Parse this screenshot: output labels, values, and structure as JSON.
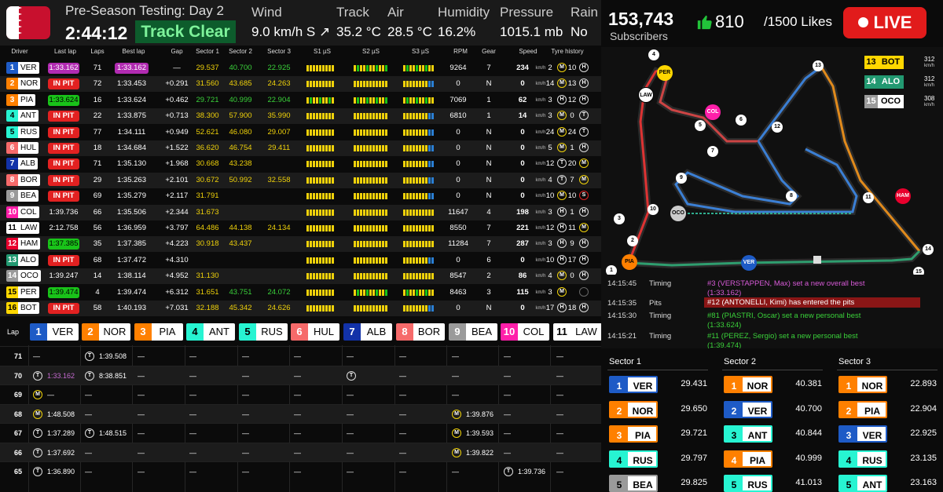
{
  "header": {
    "session": "Pre-Season Testing: Day 2",
    "clock": "2:44:12",
    "track_status": "Track Clear",
    "weather": [
      {
        "label": "Wind",
        "value": "9.0 km/h S ↗"
      },
      {
        "label": "Track",
        "value": "35.2 °C"
      },
      {
        "label": "Air",
        "value": "28.5 °C"
      },
      {
        "label": "Humidity",
        "value": "16.2%"
      },
      {
        "label": "Pressure",
        "value": "1015.1 mb"
      },
      {
        "label": "Rain",
        "value": "No"
      }
    ]
  },
  "stream": {
    "subscribers": "153,743",
    "subscribers_label": "Subscribers",
    "likes": "810",
    "likes_goal": "/1500 Likes",
    "live_label": "LIVE",
    "thumb_icon": "thumbs-up-icon"
  },
  "colors": {
    "purple": "#b12bb1",
    "green": "#19c319",
    "pit": "#e22121"
  },
  "table": {
    "headers": [
      "Driver",
      "Last lap",
      "Laps",
      "Best lap",
      "Gap",
      "Sector 1",
      "Sector 2",
      "Sector 3",
      "S1 µS",
      "S2 µS",
      "S3 µS",
      "RPM",
      "Gear",
      "Speed",
      "Tyre history"
    ],
    "speed_unit": "km/h",
    "rows": [
      {
        "pos": "1",
        "code": "VER",
        "color": "#1e5bc6",
        "last": "1:33.162",
        "last_style": "purple",
        "laps": "71",
        "best": "1:33.162",
        "best_style": "purple",
        "gap": "—",
        "s1": "29.537",
        "s1c": "yellow",
        "s2": "40.700",
        "s2c": "green",
        "s3": "22.925",
        "s3c": "green",
        "rpm": "9264",
        "gear": "7",
        "speed": "234",
        "tyres": [
          [
            "2",
            "M"
          ],
          [
            "10",
            "H"
          ]
        ]
      },
      {
        "pos": "2",
        "code": "NOR",
        "color": "#ff8000",
        "last": "IN PIT",
        "last_style": "pit",
        "laps": "72",
        "best": "1:33.453",
        "best_style": "",
        "gap": "+0.291",
        "s1": "31.560",
        "s1c": "yellow",
        "s2": "43.685",
        "s2c": "yellow",
        "s3": "24.263",
        "s3c": "yellow",
        "rpm": "0",
        "gear": "N",
        "speed": "0",
        "tyres": [
          [
            "14",
            "M"
          ],
          [
            "13",
            "H"
          ]
        ]
      },
      {
        "pos": "3",
        "code": "PIA",
        "color": "#ff8000",
        "last": "1:33.624",
        "last_style": "green",
        "laps": "16",
        "best": "1:33.624",
        "best_style": "",
        "gap": "+0.462",
        "s1": "29.721",
        "s1c": "green",
        "s2": "40.999",
        "s2c": "green",
        "s3": "22.904",
        "s3c": "green",
        "rpm": "7069",
        "gear": "1",
        "speed": "62",
        "tyres": [
          [
            "3",
            "H"
          ],
          [
            "12",
            "H"
          ]
        ]
      },
      {
        "pos": "4",
        "code": "ANT",
        "color": "#27f4d2",
        "last": "IN PIT",
        "last_style": "pit",
        "laps": "22",
        "best": "1:33.875",
        "best_style": "",
        "gap": "+0.713",
        "s1": "38.300",
        "s1c": "yellow",
        "s2": "57.900",
        "s2c": "yellow",
        "s3": "35.990",
        "s3c": "yellow",
        "rpm": "6810",
        "gear": "1",
        "speed": "14",
        "tyres": [
          [
            "3",
            "M"
          ],
          [
            "0",
            "T"
          ]
        ]
      },
      {
        "pos": "5",
        "code": "RUS",
        "color": "#27f4d2",
        "last": "IN PIT",
        "last_style": "pit",
        "laps": "77",
        "best": "1:34.111",
        "best_style": "",
        "gap": "+0.949",
        "s1": "52.621",
        "s1c": "yellow",
        "s2": "46.080",
        "s2c": "yellow",
        "s3": "29.007",
        "s3c": "yellow",
        "rpm": "0",
        "gear": "N",
        "speed": "0",
        "tyres": [
          [
            "24",
            "M"
          ],
          [
            "24",
            "T"
          ]
        ]
      },
      {
        "pos": "6",
        "code": "HUL",
        "color": "#f66a6a",
        "last": "IN PIT",
        "last_style": "pit",
        "laps": "18",
        "best": "1:34.684",
        "best_style": "",
        "gap": "+1.522",
        "s1": "36.620",
        "s1c": "yellow",
        "s2": "46.754",
        "s2c": "yellow",
        "s3": "29.411",
        "s3c": "yellow",
        "rpm": "0",
        "gear": "N",
        "speed": "0",
        "tyres": [
          [
            "5",
            "M"
          ],
          [
            "1",
            "H"
          ]
        ]
      },
      {
        "pos": "7",
        "code": "ALB",
        "color": "#1232a8",
        "last": "IN PIT",
        "last_style": "pit",
        "laps": "71",
        "best": "1:35.130",
        "best_style": "",
        "gap": "+1.968",
        "s1": "30.668",
        "s1c": "yellow",
        "s2": "43.238",
        "s2c": "yellow",
        "s3": "",
        "s3c": "yellow",
        "rpm": "0",
        "gear": "N",
        "speed": "0",
        "tyres": [
          [
            "12",
            "T"
          ],
          [
            "20",
            "M"
          ]
        ]
      },
      {
        "pos": "8",
        "code": "BOR",
        "color": "#f66a6a",
        "last": "IN PIT",
        "last_style": "pit",
        "laps": "29",
        "best": "1:35.263",
        "best_style": "",
        "gap": "+2.101",
        "s1": "30.672",
        "s1c": "yellow",
        "s2": "50.992",
        "s2c": "yellow",
        "s3": "32.558",
        "s3c": "yellow",
        "rpm": "0",
        "gear": "N",
        "speed": "0",
        "tyres": [
          [
            "4",
            "T"
          ],
          [
            "7",
            "M"
          ]
        ]
      },
      {
        "pos": "9",
        "code": "BEA",
        "color": "#9a9a9a",
        "last": "IN PIT",
        "last_style": "pit",
        "laps": "69",
        "best": "1:35.279",
        "best_style": "",
        "gap": "+2.117",
        "s1": "31.791",
        "s1c": "yellow",
        "s2": "",
        "s2c": "yellow",
        "s3": "",
        "s3c": "yellow",
        "rpm": "0",
        "gear": "N",
        "speed": "0",
        "tyres": [
          [
            "10",
            "M"
          ],
          [
            "10",
            "S"
          ]
        ]
      },
      {
        "pos": "10",
        "code": "COL",
        "color": "#ff1fa9",
        "last": "1:39.736",
        "last_style": "",
        "laps": "66",
        "best": "1:35.506",
        "best_style": "",
        "gap": "+2.344",
        "s1": "31.673",
        "s1c": "yellow",
        "s2": "",
        "s2c": "yellow",
        "s3": "",
        "s3c": "yellow",
        "rpm": "11647",
        "gear": "4",
        "speed": "198",
        "tyres": [
          [
            "3",
            "H"
          ],
          [
            "1",
            "H"
          ]
        ]
      },
      {
        "pos": "11",
        "code": "LAW",
        "color": "#ffffff",
        "last": "2:12.758",
        "last_style": "",
        "laps": "56",
        "best": "1:36.959",
        "best_style": "",
        "gap": "+3.797",
        "s1": "64.486",
        "s1c": "yellow",
        "s2": "44.138",
        "s2c": "yellow",
        "s3": "24.134",
        "s3c": "yellow",
        "rpm": "8550",
        "gear": "7",
        "speed": "221",
        "tyres": [
          [
            "12",
            "H"
          ],
          [
            "11",
            "M"
          ]
        ]
      },
      {
        "pos": "12",
        "code": "HAM",
        "color": "#e8002d",
        "last": "1:37.385",
        "last_style": "green",
        "laps": "35",
        "best": "1:37.385",
        "best_style": "",
        "gap": "+4.223",
        "s1": "30.918",
        "s1c": "yellow",
        "s2": "43.437",
        "s2c": "yellow",
        "s3": "",
        "s3c": "yellow",
        "rpm": "11284",
        "gear": "7",
        "speed": "287",
        "tyres": [
          [
            "3",
            "H"
          ],
          [
            "9",
            "H"
          ]
        ]
      },
      {
        "pos": "13",
        "code": "ALO",
        "color": "#229971",
        "last": "IN PIT",
        "last_style": "pit",
        "laps": "68",
        "best": "1:37.472",
        "best_style": "",
        "gap": "+4.310",
        "s1": "",
        "s1c": "yellow",
        "s2": "",
        "s2c": "yellow",
        "s3": "",
        "s3c": "yellow",
        "rpm": "0",
        "gear": "6",
        "speed": "0",
        "tyres": [
          [
            "10",
            "H"
          ],
          [
            "17",
            "H"
          ]
        ]
      },
      {
        "pos": "14",
        "code": "OCO",
        "color": "#9a9a9a",
        "last": "1:39.247",
        "last_style": "",
        "laps": "14",
        "best": "1:38.114",
        "best_style": "",
        "gap": "+4.952",
        "s1": "31.130",
        "s1c": "yellow",
        "s2": "",
        "s2c": "yellow",
        "s3": "",
        "s3c": "yellow",
        "rpm": "8547",
        "gear": "2",
        "speed": "86",
        "tyres": [
          [
            "4",
            "M"
          ],
          [
            "0",
            "H"
          ]
        ]
      },
      {
        "pos": "15",
        "code": "PER",
        "color": "#ffd700",
        "last": "1:39.474",
        "last_style": "green",
        "laps": "4",
        "best": "1:39.474",
        "best_style": "",
        "gap": "+6.312",
        "s1": "31.651",
        "s1c": "yellow",
        "s2": "43.751",
        "s2c": "green",
        "s3": "24.072",
        "s3c": "green",
        "rpm": "8463",
        "gear": "3",
        "speed": "115",
        "tyres": [
          [
            "3",
            "M"
          ],
          [
            "",
            ""
          ]
        ]
      },
      {
        "pos": "16",
        "code": "BOT",
        "color": "#ffd700",
        "last": "IN PIT",
        "last_style": "pit",
        "laps": "58",
        "best": "1:40.193",
        "best_style": "",
        "gap": "+7.031",
        "s1": "32.188",
        "s1c": "yellow",
        "s2": "45.342",
        "s2c": "yellow",
        "s3": "24.626",
        "s3c": "yellow",
        "rpm": "0",
        "gear": "N",
        "speed": "0",
        "tyres": [
          [
            "17",
            "H"
          ],
          [
            "18",
            "H"
          ]
        ]
      }
    ]
  },
  "lap_chart": {
    "label": "Lap",
    "drivers": [
      {
        "pos": "1",
        "code": "VER",
        "color": "#1e5bc6"
      },
      {
        "pos": "2",
        "code": "NOR",
        "color": "#ff8000"
      },
      {
        "pos": "3",
        "code": "PIA",
        "color": "#ff8000"
      },
      {
        "pos": "4",
        "code": "ANT",
        "color": "#27f4d2"
      },
      {
        "pos": "5",
        "code": "RUS",
        "color": "#27f4d2"
      },
      {
        "pos": "6",
        "code": "HUL",
        "color": "#f66a6a"
      },
      {
        "pos": "7",
        "code": "ALB",
        "color": "#1232a8"
      },
      {
        "pos": "8",
        "code": "BOR",
        "color": "#f66a6a"
      },
      {
        "pos": "9",
        "code": "BEA",
        "color": "#9a9a9a"
      },
      {
        "pos": "10",
        "code": "COL",
        "color": "#ff1fa9"
      },
      {
        "pos": "11",
        "code": "LAW",
        "color": "#ffffff"
      }
    ],
    "rows": [
      {
        "lap": "71",
        "cells": [
          "—",
          "T|1:39.508",
          "—",
          "—",
          "—",
          "—",
          "—",
          "—",
          "—",
          "—",
          "—"
        ]
      },
      {
        "lap": "70",
        "cells": [
          "T|1:33.162",
          "T|8:38.851",
          "—",
          "—",
          "—",
          "—",
          "T|",
          "—",
          "—",
          "—",
          "—"
        ]
      },
      {
        "lap": "69",
        "cells": [
          "M|—",
          "—",
          "—",
          "—",
          "—",
          "—",
          "—",
          "—",
          "—",
          "—",
          "—"
        ]
      },
      {
        "lap": "68",
        "cells": [
          "M|1:48.508",
          "—",
          "—",
          "—",
          "—",
          "—",
          "—",
          "—",
          "M|1:39.876",
          "—",
          "—"
        ]
      },
      {
        "lap": "67",
        "cells": [
          "T|1:37.289",
          "T|1:48.515",
          "—",
          "—",
          "—",
          "—",
          "—",
          "—",
          "M|1:39.593",
          "—",
          "—"
        ]
      },
      {
        "lap": "66",
        "cells": [
          "T|1:37.692",
          "—",
          "—",
          "—",
          "—",
          "—",
          "—",
          "—",
          "M|1:39.822",
          "—",
          "—"
        ]
      },
      {
        "lap": "65",
        "cells": [
          "T|1:36.890",
          "—",
          "—",
          "—",
          "—",
          "—",
          "—",
          "—",
          "—",
          "T|1:39.736",
          "—"
        ]
      }
    ]
  },
  "track_map": {
    "markers": [
      {
        "code": "PER",
        "color": "#ffd700",
        "text": "#000"
      },
      {
        "code": "LAW",
        "color": "#ffffff",
        "text": "#000"
      },
      {
        "code": "COL",
        "color": "#ff1fa9",
        "text": "#fff"
      },
      {
        "code": "OCO",
        "color": "#cccccc",
        "text": "#000"
      },
      {
        "code": "HAM",
        "color": "#e8002d",
        "text": "#fff"
      },
      {
        "code": "PIA",
        "color": "#ff8000",
        "text": "#000"
      },
      {
        "code": "VER",
        "color": "#1e5bc6",
        "text": "#fff"
      }
    ],
    "turns": [
      "4",
      "13",
      "5",
      "6",
      "7",
      "12",
      "9",
      "8",
      "10",
      "11",
      "3",
      "2",
      "1",
      "15",
      "14"
    ],
    "mini_ranking": [
      {
        "pos": "13",
        "code": "BOT",
        "color": "#ffd700",
        "speed": "312",
        "unit": "km/h"
      },
      {
        "pos": "14",
        "code": "ALO",
        "color": "#229971",
        "speed": "312",
        "unit": "km/h"
      },
      {
        "pos": "15",
        "code": "OCO",
        "color": "#9a9a9a",
        "speed": "308",
        "unit": "km/h"
      }
    ]
  },
  "messages": [
    {
      "time": "14:15:45",
      "category": "Timing",
      "text": "#3 (VERSTAPPEN, Max) set a new overall best",
      "text2": "(1:33.162)",
      "color": "#d65ad6",
      "highlight": false
    },
    {
      "time": "14:15:35",
      "category": "Pits",
      "text": "#12 (ANTONELLI, Kimi) has entered the pits",
      "text2": "",
      "color": "#ffffff",
      "highlight": true
    },
    {
      "time": "14:15:30",
      "category": "Timing",
      "text": "#81 (PIASTRI, Oscar) set a new personal best",
      "text2": "(1:33.624)",
      "color": "#3ad13a",
      "highlight": false
    },
    {
      "time": "14:15:21",
      "category": "Timing",
      "text": "#11 (PEREZ, Sergio) set a new personal best",
      "text2": "(1:39.474)",
      "color": "#3ad13a",
      "highlight": false
    }
  ],
  "sectors": [
    {
      "title": "Sector 1",
      "rows": [
        {
          "pos": "1",
          "code": "VER",
          "color": "#1e5bc6",
          "time": "29.431"
        },
        {
          "pos": "2",
          "code": "NOR",
          "color": "#ff8000",
          "time": "29.650"
        },
        {
          "pos": "3",
          "code": "PIA",
          "color": "#ff8000",
          "time": "29.721"
        },
        {
          "pos": "4",
          "code": "RUS",
          "color": "#27f4d2",
          "time": "29.797"
        },
        {
          "pos": "5",
          "code": "BEA",
          "color": "#9a9a9a",
          "time": "29.825"
        }
      ]
    },
    {
      "title": "Sector 2",
      "rows": [
        {
          "pos": "1",
          "code": "NOR",
          "color": "#ff8000",
          "time": "40.381"
        },
        {
          "pos": "2",
          "code": "VER",
          "color": "#1e5bc6",
          "time": "40.700"
        },
        {
          "pos": "3",
          "code": "ANT",
          "color": "#27f4d2",
          "time": "40.844"
        },
        {
          "pos": "4",
          "code": "PIA",
          "color": "#ff8000",
          "time": "40.999"
        },
        {
          "pos": "5",
          "code": "RUS",
          "color": "#27f4d2",
          "time": "41.013"
        }
      ]
    },
    {
      "title": "Sector 3",
      "rows": [
        {
          "pos": "1",
          "code": "NOR",
          "color": "#ff8000",
          "time": "22.893"
        },
        {
          "pos": "2",
          "code": "PIA",
          "color": "#ff8000",
          "time": "22.904"
        },
        {
          "pos": "3",
          "code": "VER",
          "color": "#1e5bc6",
          "time": "22.925"
        },
        {
          "pos": "4",
          "code": "RUS",
          "color": "#27f4d2",
          "time": "23.135"
        },
        {
          "pos": "5",
          "code": "ANT",
          "color": "#27f4d2",
          "time": "23.163"
        }
      ]
    }
  ]
}
